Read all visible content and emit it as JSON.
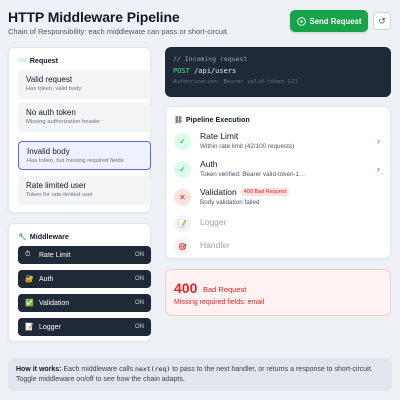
{
  "header": {
    "title": "HTTP Middleware Pipeline",
    "subtitle": "Chain of Responsibility: each middleware can pass or short-circuit.",
    "send_label": "Send Request"
  },
  "request_panel": {
    "heading": "Request",
    "options": [
      {
        "name": "Valid request",
        "desc": "Has token, valid body",
        "selected": false
      },
      {
        "name": "No auth token",
        "desc": "Missing authorization header",
        "selected": false
      },
      {
        "name": "Invalid body",
        "desc": "Has token, but missing required fields",
        "selected": true
      },
      {
        "name": "Rate limited user",
        "desc": "Token for rate-limited user",
        "selected": false
      }
    ]
  },
  "middleware_panel": {
    "heading": "Middleware",
    "items": [
      {
        "name": "Rate Limit",
        "state": "ON",
        "icon": "stopwatch-icon"
      },
      {
        "name": "Auth",
        "state": "ON",
        "icon": "lock-icon"
      },
      {
        "name": "Validation",
        "state": "ON",
        "icon": "check-box-icon"
      },
      {
        "name": "Logger",
        "state": "ON",
        "icon": "memo-icon"
      }
    ]
  },
  "incoming": {
    "comment": "// Incoming request",
    "method": "POST",
    "path": "/api/users",
    "auth": "Authorization: Bearer valid-token-123"
  },
  "pipeline": {
    "heading": "Pipeline Execution",
    "steps": [
      {
        "name": "Rate Limit",
        "detail": "Within rate limit (42/100 requests)",
        "status": "passed"
      },
      {
        "name": "Auth",
        "detail": "Token verified: Bearer valid-token-1…",
        "status": "passed"
      },
      {
        "name": "Validation",
        "badge": "400 Bad Request",
        "detail": "Body validation failed",
        "status": "failed"
      },
      {
        "name": "Logger",
        "status": "skipped"
      },
      {
        "name": "Handler",
        "status": "skipped"
      }
    ]
  },
  "response": {
    "code": "400",
    "status": "Bad Request",
    "message": "Missing required fields: email"
  },
  "footer": {
    "lead": "How it works:",
    "text1": " Each middleware calls ",
    "code": "next(req)",
    "text2": " to pass to the next handler, or returns a response to short-circuit. Toggle middleware on/off to see how the chain adapts."
  },
  "colors": {
    "primary": "#16a34a",
    "error": "#dc2626",
    "selected": "#6366f1",
    "dark": "#1f2937"
  }
}
